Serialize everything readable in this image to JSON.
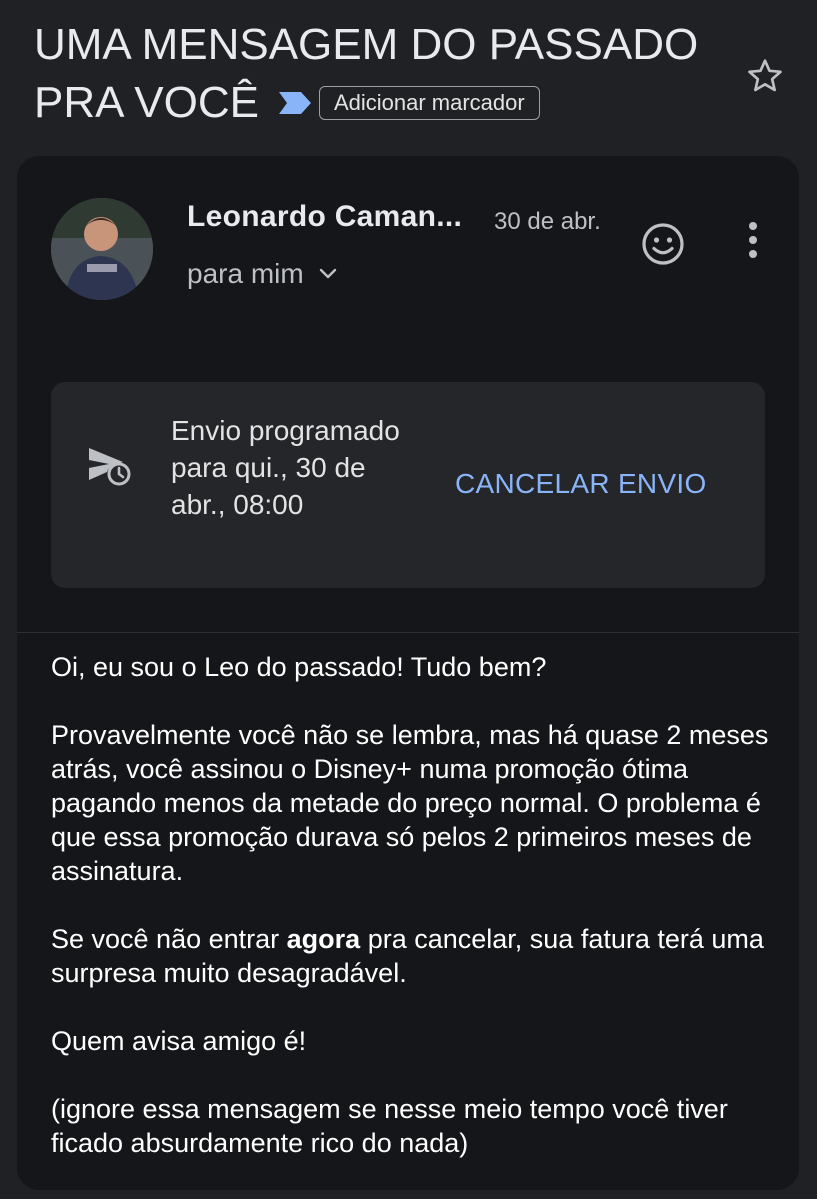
{
  "email": {
    "subject_line1": "UMA MENSAGEM DO PASSADO",
    "subject_line2": "PRA VOCÊ",
    "add_label": "Adicionar marcador",
    "sender": "Leonardo Caman...",
    "date": "30 de abr.",
    "to": "para mim",
    "scheduled": {
      "text": "Envio programado para qui., 30 de abr., 08:00",
      "cancel_label": "CANCELAR ENVIO"
    },
    "body": {
      "p1": "Oi, eu sou o Leo do passado! Tudo bem?",
      "p2": "Provavelmente você não se lembra, mas há quase 2 meses atrás, você assinou o Disney+ numa promoção ótima pagando menos da metade do preço normal. O problema é que essa promoção durava só pelos 2 primeiros meses de assinatura.",
      "p3_before": "Se você não entrar ",
      "p3_bold": "agora",
      "p3_after": " pra cancelar, sua fatura terá uma surpresa muito desagradável.",
      "p4": "Quem avisa amigo é!",
      "p5": "(ignore essa mensagem se nesse meio tempo você tiver ficado absurdamente rico do nada)"
    }
  },
  "icons": {
    "star": "star-outline-icon",
    "importance": "importance-marker-icon",
    "emoji": "emoji-reaction-icon",
    "more": "more-vert-icon",
    "expand": "chevron-down-icon",
    "schedule": "scheduled-send-icon"
  },
  "colors": {
    "background": "#202124",
    "card": "#151619",
    "accent": "#8ab4f8",
    "importance": "#8ab4f8"
  }
}
